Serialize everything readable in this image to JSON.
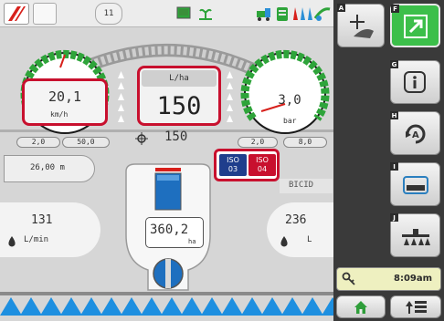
{
  "topbar": {
    "counter": "11"
  },
  "speed_gauge": {
    "value": "20,1",
    "unit": "km/h",
    "range_min": "2,0",
    "range_max": "50,0"
  },
  "pressure_gauge": {
    "value": "3,0",
    "unit": "bar",
    "range_min": "2,0",
    "range_max": "8,0"
  },
  "rate": {
    "unit": "L/ha",
    "value": "150",
    "target": "150"
  },
  "width_readout": "26,00 m",
  "iso": {
    "first_top": "ISO",
    "first_bottom": "03",
    "second_top": "ISO",
    "second_bottom": "04"
  },
  "product_label": "BICID",
  "left_flow": {
    "value": "131",
    "unit": "L/min"
  },
  "right_tank": {
    "value": "236",
    "unit": "L"
  },
  "area": {
    "value": "360,2",
    "unit": "ha"
  },
  "sidebar": {
    "letters": [
      "A",
      "F",
      "G",
      "H",
      "I",
      "J"
    ],
    "time": "8:09am"
  },
  "colors": {
    "gauge_green": "#2ea43a",
    "highlight_red": "#c8102e",
    "active_green": "#3cbf4a",
    "iso_blue": "#1f3e8c"
  }
}
